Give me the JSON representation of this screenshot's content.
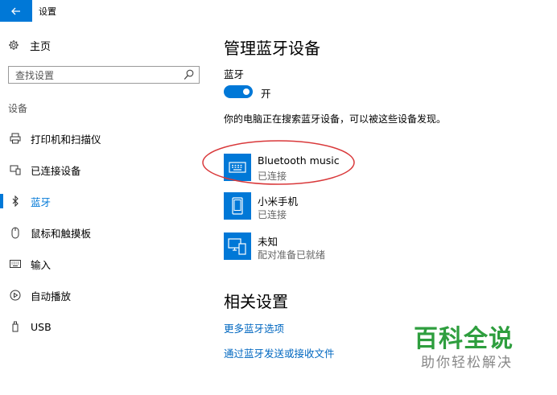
{
  "window": {
    "title": "设置"
  },
  "sidebar": {
    "home_label": "主页",
    "search_placeholder": "查找设置",
    "section_label": "设备",
    "items": [
      {
        "label": "打印机和扫描仪",
        "icon": "printer-icon"
      },
      {
        "label": "已连接设备",
        "icon": "connected-devices-icon"
      },
      {
        "label": "蓝牙",
        "icon": "bluetooth-icon",
        "active": true
      },
      {
        "label": "鼠标和触摸板",
        "icon": "mouse-icon"
      },
      {
        "label": "输入",
        "icon": "keyboard-icon"
      },
      {
        "label": "自动播放",
        "icon": "autoplay-icon"
      },
      {
        "label": "USB",
        "icon": "usb-icon"
      }
    ]
  },
  "main": {
    "title": "管理蓝牙设备",
    "bluetooth_label": "蓝牙",
    "toggle_state": "开",
    "status_text": "你的电脑正在搜索蓝牙设备，可以被这些设备发现。",
    "devices": [
      {
        "name": "Bluetooth music",
        "status": "已连接",
        "icon": "keyboard-device-icon",
        "highlighted": true
      },
      {
        "name": "小米手机",
        "status": "已连接",
        "icon": "phone-device-icon"
      },
      {
        "name": "未知",
        "status": "配对准备已就绪",
        "icon": "unknown-device-icon"
      }
    ],
    "related_title": "相关设置",
    "links": [
      "更多蓝牙选项",
      "通过蓝牙发送或接收文件"
    ]
  },
  "watermark": {
    "main": "百科全说",
    "sub": "助你轻松解决"
  },
  "colors": {
    "accent": "#0078d7",
    "highlight": "#d9383a",
    "watermark": "#2e9e3e"
  }
}
